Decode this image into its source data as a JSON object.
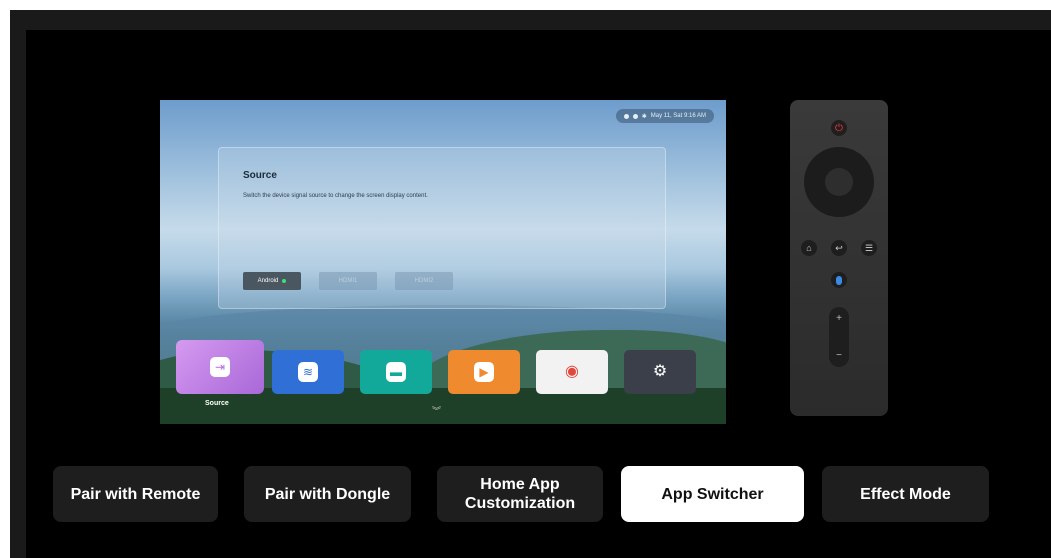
{
  "tv": {
    "status_text": "May 11, Sat 9:16 AM",
    "source_panel": {
      "title": "Source",
      "description": "Switch the device signal source to change the screen display content.",
      "buttons": [
        {
          "label": "Android",
          "active": true
        },
        {
          "label": "HDMI1",
          "active": false
        },
        {
          "label": "HDMI2",
          "active": false
        }
      ]
    },
    "apps": [
      {
        "name": "source-app",
        "icon": "input-arrow-icon",
        "glyph": "⇥",
        "color": "#c07be0",
        "selected": true
      },
      {
        "name": "screen-cast-app",
        "icon": "wifi-cast-icon",
        "glyph": "≋",
        "color": "#2f6fd6",
        "selected": false
      },
      {
        "name": "file-manager-app",
        "icon": "folder-icon",
        "glyph": "▬",
        "color": "#13a99a",
        "selected": false
      },
      {
        "name": "video-player-app",
        "icon": "play-icon",
        "glyph": "▶",
        "color": "#f08a2e",
        "selected": false
      },
      {
        "name": "chrome-app",
        "icon": "chrome-icon",
        "glyph": "◉",
        "color": "#f2f2f2",
        "selected": false
      },
      {
        "name": "settings-app",
        "icon": "gear-icon",
        "glyph": "⚙",
        "color": "#3b3f4a",
        "selected": false
      }
    ],
    "selected_app_label": "Source",
    "chevron_glyph": "︾"
  },
  "remote": {
    "power_glyph": "⏻",
    "home_glyph": "⌂",
    "back_glyph": "↩",
    "menu_glyph": "☰",
    "vol_up_glyph": "+",
    "vol_down_glyph": "−"
  },
  "tabs": [
    {
      "label": "Pair with Remote",
      "active": false
    },
    {
      "label": "Pair with Dongle",
      "active": false
    },
    {
      "label": "Home App Customization",
      "active": false
    },
    {
      "label": "App Switcher",
      "active": true
    },
    {
      "label": "Effect Mode",
      "active": false
    }
  ],
  "colors": {
    "accent_green": "#3be07a",
    "power_red": "#ff3b3b",
    "mic_blue": "#3a8be8"
  }
}
